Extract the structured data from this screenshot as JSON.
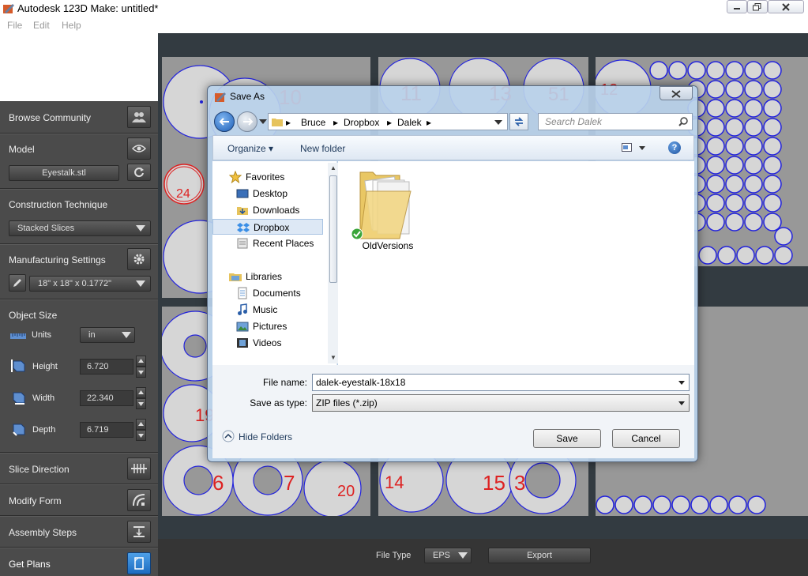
{
  "window": {
    "title": "Autodesk 123D Make: untitled*"
  },
  "menu": [
    "File",
    "Edit",
    "Help"
  ],
  "left_panel": {
    "browse_community": "Browse Community",
    "model": "Model",
    "model_file": "Eyestalk.stl",
    "construction_technique": "Construction Technique",
    "technique_value": "Stacked Slices",
    "manufacturing_settings": "Manufacturing Settings",
    "material_value": "18\" x 18\" x 0.1772\"",
    "object_size": "Object Size",
    "units_label": "Units",
    "units_value": "in",
    "height_label": "Height",
    "height_value": "6.720",
    "width_label": "Width",
    "width_value": "22.340",
    "depth_label": "Depth",
    "depth_value": "6.719",
    "slice_direction": "Slice Direction",
    "modify_form": "Modify Form",
    "assembly_steps": "Assembly Steps",
    "get_plans": "Get Plans"
  },
  "bottom_bar": {
    "file_type_label": "File Type",
    "file_type_value": "EPS",
    "export_label": "Export"
  },
  "sheets": {
    "labels": [
      "24",
      "10",
      "11",
      "13",
      "51",
      "12",
      "19",
      "6",
      "7",
      "20",
      "14",
      "15",
      "3"
    ]
  },
  "dialog": {
    "title": "Save As",
    "path": [
      "Bruce",
      "Dropbox",
      "Dalek"
    ],
    "search_placeholder": "Search Dalek",
    "organize": "Organize",
    "new_folder": "New folder",
    "favorites_label": "Favorites",
    "favorites": [
      "Desktop",
      "Downloads",
      "Dropbox",
      "Recent Places"
    ],
    "libraries_label": "Libraries",
    "libraries": [
      "Documents",
      "Music",
      "Pictures",
      "Videos"
    ],
    "folder_name": "OldVersions",
    "file_name_label": "File name:",
    "file_name_value": "dalek-eyestalk-18x18",
    "save_type_label": "Save as type:",
    "save_type_value": "ZIP files (*.zip)",
    "hide_folders": "Hide Folders",
    "save_label": "Save",
    "cancel_label": "Cancel"
  },
  "colors": {
    "panel": "#4b4b4b",
    "sheet": "#989898",
    "cut_line": "#2222dd",
    "label_red": "#e02020",
    "dialog_frame": "#b9d1ea"
  }
}
